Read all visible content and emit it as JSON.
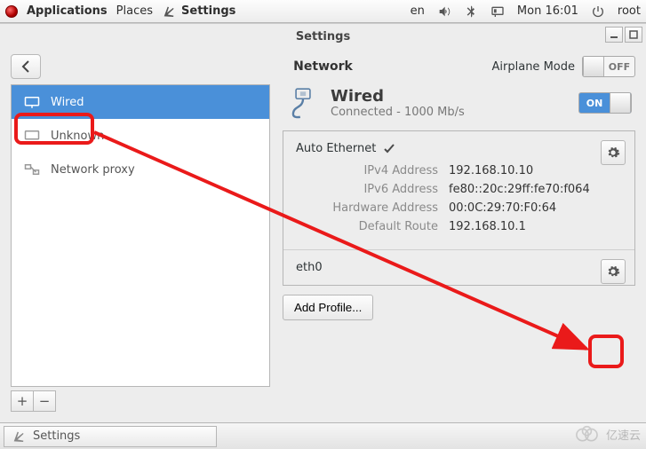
{
  "panel": {
    "app_menu": "Applications",
    "places": "Places",
    "active_app": "Settings",
    "lang": "en",
    "clock": "Mon 16:01",
    "user": "root"
  },
  "window": {
    "title": "Settings",
    "subtitle": "Network",
    "airplane_label": "Airplane Mode",
    "airplane_off": "OFF"
  },
  "sidebar": {
    "items": [
      {
        "label": "Wired"
      },
      {
        "label": "Unknown"
      },
      {
        "label": "Network proxy"
      }
    ],
    "add": "+",
    "remove": "−"
  },
  "pane": {
    "title": "Wired",
    "status": "Connected - 1000 Mb/s",
    "switch_on": "ON",
    "profile_name": "Auto Ethernet",
    "rows": {
      "ipv4_k": "IPv4 Address",
      "ipv4_v": "192.168.10.10",
      "ipv6_k": "IPv6 Address",
      "ipv6_v": "fe80::20c:29ff:fe70:f064",
      "hw_k": "Hardware Address",
      "hw_v": "00:0C:29:70:F0:64",
      "route_k": "Default Route",
      "route_v": "192.168.10.1"
    },
    "iface": "eth0",
    "add_profile": "Add Profile..."
  },
  "taskbar": {
    "item": "Settings"
  },
  "watermark": "亿速云"
}
